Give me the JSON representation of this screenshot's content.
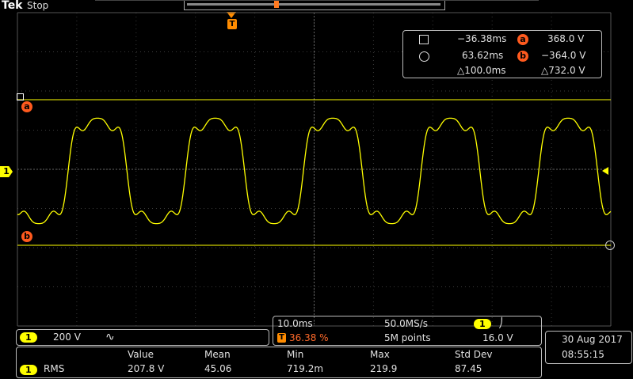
{
  "top": {
    "brand": "Tek",
    "status": "Stop",
    "trigger_marker": "T"
  },
  "cursor_readout": {
    "a_time": "−36.38ms",
    "a_label": "a",
    "a_value": "368.0 V",
    "b_time": "63.62ms",
    "b_label": "b",
    "b_value": "−364.0 V",
    "delta_time": "△100.0ms",
    "delta_value": "△732.0 V"
  },
  "markers": {
    "cursor_a": "a",
    "cursor_b": "b",
    "channel": "1"
  },
  "channel_box": {
    "channel": "1",
    "scale": "200 V",
    "coupling_icon": "∿"
  },
  "timebase": {
    "time_div": "10.0ms",
    "sample_rate": "50.0MS/s",
    "trigger_label": "T",
    "trigger_pos": "36.38 %",
    "record_length": "5M points",
    "trigger_channel": "1",
    "trigger_slope": "⎠",
    "trigger_level": "16.0 V"
  },
  "datetime": {
    "date": "30 Aug 2017",
    "time": "08:55:15"
  },
  "measurements": {
    "headers": [
      "Value",
      "Mean",
      "Min",
      "Max",
      "Std Dev"
    ],
    "channel": "1",
    "type": "RMS",
    "values": [
      "207.8 V",
      "45.06",
      "719.2m",
      "219.9",
      "87.45"
    ]
  },
  "colors": {
    "trace": "#ffff00",
    "cursor": "#ff5a1e",
    "grid": "#555555"
  }
}
